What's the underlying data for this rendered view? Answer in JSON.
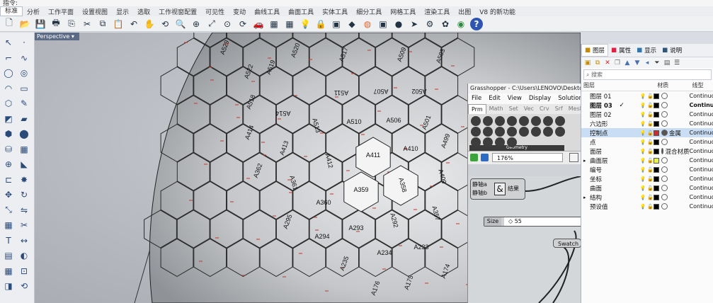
{
  "titlebar": {
    "text": "指令:"
  },
  "menubar": {
    "items": [
      "标准",
      "分析",
      "工作平面",
      "设置视图",
      "显示",
      "选取",
      "工作视窗配置",
      "可见性",
      "变动",
      "曲线工具",
      "曲面工具",
      "实体工具",
      "细分工具",
      "网格工具",
      "渲染工具",
      "出图",
      "V8 的新功能"
    ]
  },
  "toolbar": {
    "icons": [
      "new-icon",
      "open-icon",
      "save-icon",
      "print-icon",
      "import-icon",
      "cut-icon",
      "copy-icon",
      "paste-icon",
      "undo-icon",
      "pan-icon",
      "rotate-view-icon",
      "zoom-icon",
      "zoom-window-icon",
      "zoom-extents-icon",
      "zoom-selected-icon",
      "undo-view-icon",
      "car-icon",
      "render-icon",
      "grid-icon",
      "lightbulb-icon",
      "padlock-icon",
      "texture-icon",
      "box-icon",
      "color-wheel-icon",
      "material-icon",
      "sphere-render-icon",
      "arrow-icon",
      "gear-icon",
      "grasshopper-icon",
      "globe-icon",
      "help-icon"
    ]
  },
  "viewport": {
    "tab_label": "Perspective"
  },
  "panels": {
    "tiles": [
      {
        "label": "A520",
        "hx": 420,
        "hy": 72
      },
      {
        "label": "A519",
        "hx": 385,
        "hy": 96
      },
      {
        "label": "A517",
        "hx": 488,
        "hy": 78
      },
      {
        "label": "A509",
        "hx": 570,
        "hy": 78
      },
      {
        "label": "A503",
        "hx": 625,
        "hy": 80
      },
      {
        "label": "A529",
        "hx": 320,
        "hy": 68
      },
      {
        "label": "A522",
        "hx": 354,
        "hy": 102
      },
      {
        "label": "A511",
        "hx": 482,
        "hy": 128
      },
      {
        "label": "A507",
        "hx": 538,
        "hy": 126
      },
      {
        "label": "A502",
        "hx": 592,
        "hy": 126
      },
      {
        "label": "A518",
        "hx": 357,
        "hy": 145
      },
      {
        "label": "A514",
        "hx": 400,
        "hy": 157
      },
      {
        "label": "A513",
        "hx": 444,
        "hy": 178
      },
      {
        "label": "A510",
        "hx": 500,
        "hy": 175
      },
      {
        "label": "A506",
        "hx": 556,
        "hy": 173
      },
      {
        "label": "A501",
        "hx": 605,
        "hy": 174
      },
      {
        "label": "A414",
        "hx": 355,
        "hy": 188
      },
      {
        "label": "A413",
        "hx": 404,
        "hy": 210
      },
      {
        "label": "A412",
        "hx": 462,
        "hy": 228
      },
      {
        "label": "A411",
        "hx": 527,
        "hy": 222
      },
      {
        "label": "A410",
        "hx": 580,
        "hy": 213
      },
      {
        "label": "A409",
        "hx": 622,
        "hy": 250
      },
      {
        "label": "A499",
        "hx": 632,
        "hy": 200
      },
      {
        "label": "A362",
        "hx": 367,
        "hy": 242
      },
      {
        "label": "A361",
        "hx": 412,
        "hy": 259
      },
      {
        "label": "A360",
        "hx": 457,
        "hy": 289
      },
      {
        "label": "A359",
        "hx": 510,
        "hy": 271
      },
      {
        "label": "A358",
        "hx": 566,
        "hy": 262
      },
      {
        "label": "A357",
        "hx": 613,
        "hy": 302
      },
      {
        "label": "A295",
        "hx": 409,
        "hy": 314
      },
      {
        "label": "A294",
        "hx": 455,
        "hy": 337
      },
      {
        "label": "A293",
        "hx": 503,
        "hy": 325
      },
      {
        "label": "A292",
        "hx": 554,
        "hy": 312
      },
      {
        "label": "A235",
        "hx": 489,
        "hy": 373
      },
      {
        "label": "A234",
        "hx": 543,
        "hy": 360
      },
      {
        "label": "A233",
        "hx": 595,
        "hy": 352
      },
      {
        "label": "A176",
        "hx": 533,
        "hy": 408
      },
      {
        "label": "A175",
        "hx": 580,
        "hy": 400
      },
      {
        "label": "A174",
        "hx": 632,
        "hy": 384
      }
    ]
  },
  "grasshopper": {
    "title": "Grasshopper - C:\\Users\\LENOVO\\Desktop\\定制...",
    "menu": [
      "File",
      "Edit",
      "View",
      "Display",
      "Solution"
    ],
    "tabs": [
      "Prm",
      "Math",
      "Set",
      "Vec",
      "Crv",
      "Srf",
      "Mesh"
    ],
    "ribbon_group": "Geometry",
    "zoom": "176%",
    "node_inputs": [
      "静轴a",
      "静轴b"
    ],
    "node_output": "结果",
    "node_symbol": "&",
    "size_label": "Size",
    "size_value": "◇ 55",
    "swatch_label": "Swatch"
  },
  "layers_panel": {
    "tabs": [
      "图层",
      "属性",
      "显示",
      "说明"
    ],
    "search_placeholder": "搜索",
    "headers": {
      "name": "图层",
      "material": "材质",
      "linetype": "线型"
    },
    "rows": [
      {
        "name": "图层 01",
        "current": false,
        "selected": false,
        "color": "#000000",
        "material": "",
        "linetype": "Continuo",
        "bold": false
      },
      {
        "name": "图层 03",
        "current": true,
        "selected": false,
        "color": "#000000",
        "material": "",
        "linetype": "Continuo",
        "bold": true
      },
      {
        "name": "图层 02",
        "current": false,
        "selected": false,
        "color": "#000000",
        "material": "",
        "linetype": "Continuo",
        "bold": false
      },
      {
        "name": "六边形",
        "current": false,
        "selected": false,
        "color": "#000000",
        "material": "",
        "linetype": "Continuo",
        "bold": false
      },
      {
        "name": "控制点",
        "current": false,
        "selected": true,
        "color": "#cc2b2b",
        "material": "金属",
        "linetype": "Continuo",
        "bold": false
      },
      {
        "name": "点",
        "current": false,
        "selected": false,
        "color": "#000000",
        "material": "",
        "linetype": "Continuo",
        "bold": false
      },
      {
        "name": "面层",
        "current": false,
        "selected": false,
        "color": "#000000",
        "material": "混合材质",
        "linetype": "Continuo",
        "bold": false
      },
      {
        "name": "曲面层",
        "current": false,
        "selected": false,
        "color": "#e8f04a",
        "material": "",
        "linetype": "Continuo",
        "bold": false
      },
      {
        "name": "编号",
        "current": false,
        "selected": false,
        "color": "#000000",
        "material": "",
        "linetype": "Continuo",
        "bold": false
      },
      {
        "name": "坐标",
        "current": false,
        "selected": false,
        "color": "#000000",
        "material": "",
        "linetype": "Continuo",
        "bold": false
      },
      {
        "name": "曲面",
        "current": false,
        "selected": false,
        "color": "#000000",
        "material": "",
        "linetype": "Continuo",
        "bold": false
      },
      {
        "name": "结构",
        "current": false,
        "selected": false,
        "color": "#000000",
        "material": "",
        "linetype": "Continuo",
        "bold": false
      },
      {
        "name": "预设值",
        "current": false,
        "selected": false,
        "color": "#000000",
        "material": "",
        "linetype": "Continuo",
        "bold": false
      }
    ]
  },
  "colors": {
    "accent": "#5b6b86",
    "selection": "#c9def5",
    "panel_highlight": "#ffffff"
  }
}
